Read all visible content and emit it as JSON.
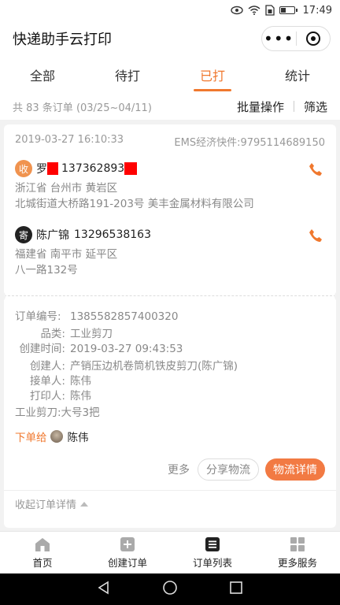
{
  "status_bar": {
    "time": "17:49",
    "icons": [
      "eye-icon",
      "wifi-icon",
      "sim-icon",
      "battery-icon"
    ]
  },
  "header": {
    "title": "快递助手云打印",
    "menu_icon": "more-dots-icon",
    "close_icon": "target-icon"
  },
  "tabs": [
    {
      "label": "全部",
      "active": false
    },
    {
      "label": "待打",
      "active": false
    },
    {
      "label": "已打",
      "active": true
    },
    {
      "label": "统计",
      "active": false
    }
  ],
  "summary": {
    "count_text": "共 83 条订单 (03/25~04/11)",
    "batch_label": "批量操作",
    "filter_label": "筛选"
  },
  "order": {
    "datetime": "2019-03-27 16:10:33",
    "carrier": "EMS经济快件:9795114689150",
    "receiver": {
      "badge": "收",
      "name": "罗",
      "phone": "137362893",
      "region": "浙江省 台州市 黄岩区",
      "address": "北城街道大桥路191-203号 美丰金属材料有限公司"
    },
    "sender": {
      "badge": "寄",
      "name": "陈广锦",
      "phone": "13296538163",
      "region": "福建省 南平市 延平区",
      "address": "八一路132号"
    },
    "details": {
      "order_no_label": "订单编号:",
      "order_no": "1385582857400320",
      "category_label": "品类:",
      "category": "工业剪刀",
      "created_label": "创建时间:",
      "created": "2019-03-27 09:43:53",
      "creator_label": "创建人:",
      "creator": "产销压边机卷筒机铁皮剪刀(陈广锦)",
      "receiver_label": "接单人:",
      "receiver_person": "陈伟",
      "printer_label": "打印人:",
      "printer": "陈伟",
      "goods_note": "工业剪刀:大号3把"
    },
    "assigned_label": "下单给",
    "assigned_to": "陈伟",
    "more_label": "更多",
    "share_label": "分享物流",
    "logistics_label": "物流详情",
    "collapse_label": "收起订单详情"
  },
  "bottom_nav": [
    {
      "label": "首页",
      "icon": "home-icon"
    },
    {
      "label": "创建订单",
      "icon": "plus-square-icon"
    },
    {
      "label": "订单列表",
      "icon": "list-icon"
    },
    {
      "label": "更多服务",
      "icon": "grid-icon"
    }
  ],
  "colors": {
    "accent": "#f0782e",
    "primary_button": "#f27a43",
    "receiver_badge": "#f0934f",
    "sender_badge": "#222222"
  }
}
